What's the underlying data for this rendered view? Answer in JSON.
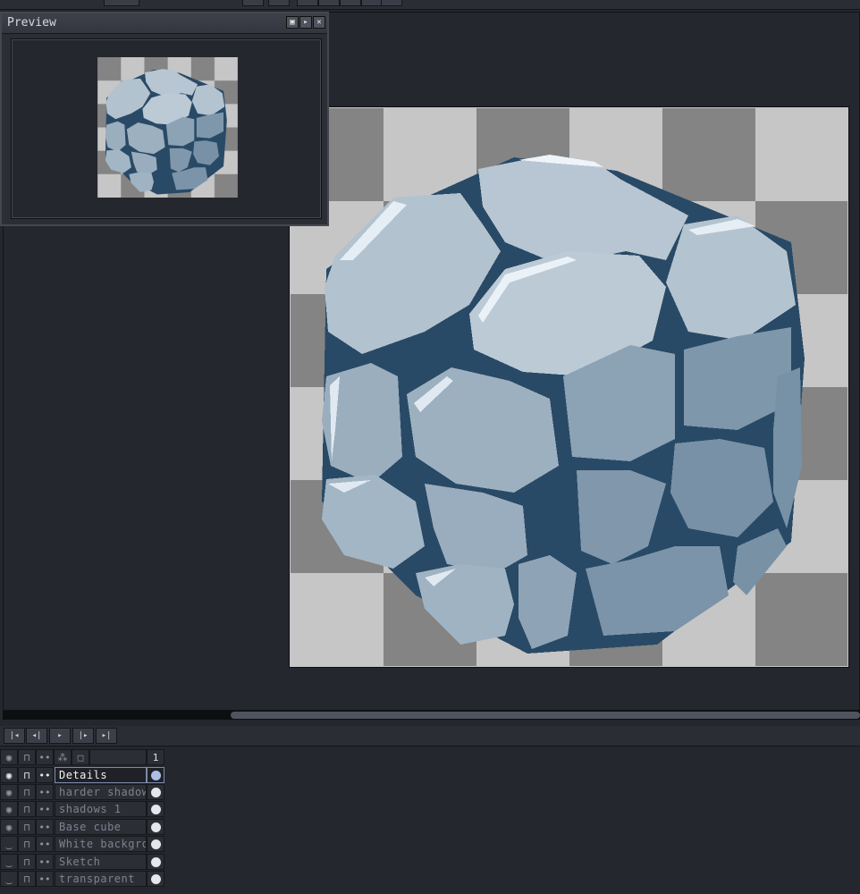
{
  "preview": {
    "title": "Preview",
    "buttons": [
      "restore-icon",
      "play-icon",
      "close-icon"
    ]
  },
  "playback": {
    "buttons": [
      "first-frame-icon",
      "prev-frame-icon",
      "play-icon",
      "next-frame-icon",
      "last-frame-icon"
    ]
  },
  "timeline": {
    "frame_number": "1",
    "layers": [
      {
        "name": "Details",
        "visible": true,
        "selected": true
      },
      {
        "name": "harder shadow",
        "visible": true,
        "selected": false
      },
      {
        "name": "shadows 1",
        "visible": true,
        "selected": false
      },
      {
        "name": "Base cube",
        "visible": true,
        "selected": false
      },
      {
        "name": "White background",
        "visible": false,
        "selected": false
      },
      {
        "name": "Sketch",
        "visible": false,
        "selected": false
      },
      {
        "name": "transparent",
        "visible": false,
        "selected": false
      }
    ]
  },
  "colors": {
    "background": "#25272e",
    "checker_light": "#c6c6c6",
    "checker_dark": "#848484",
    "stone_light": "#b9c7d3",
    "stone_mid": "#9db0c0",
    "stone_dark": "#7a93a9",
    "mortar": "#294a66",
    "highlight": "#eef4f9",
    "selection": "#7d8aa8"
  }
}
